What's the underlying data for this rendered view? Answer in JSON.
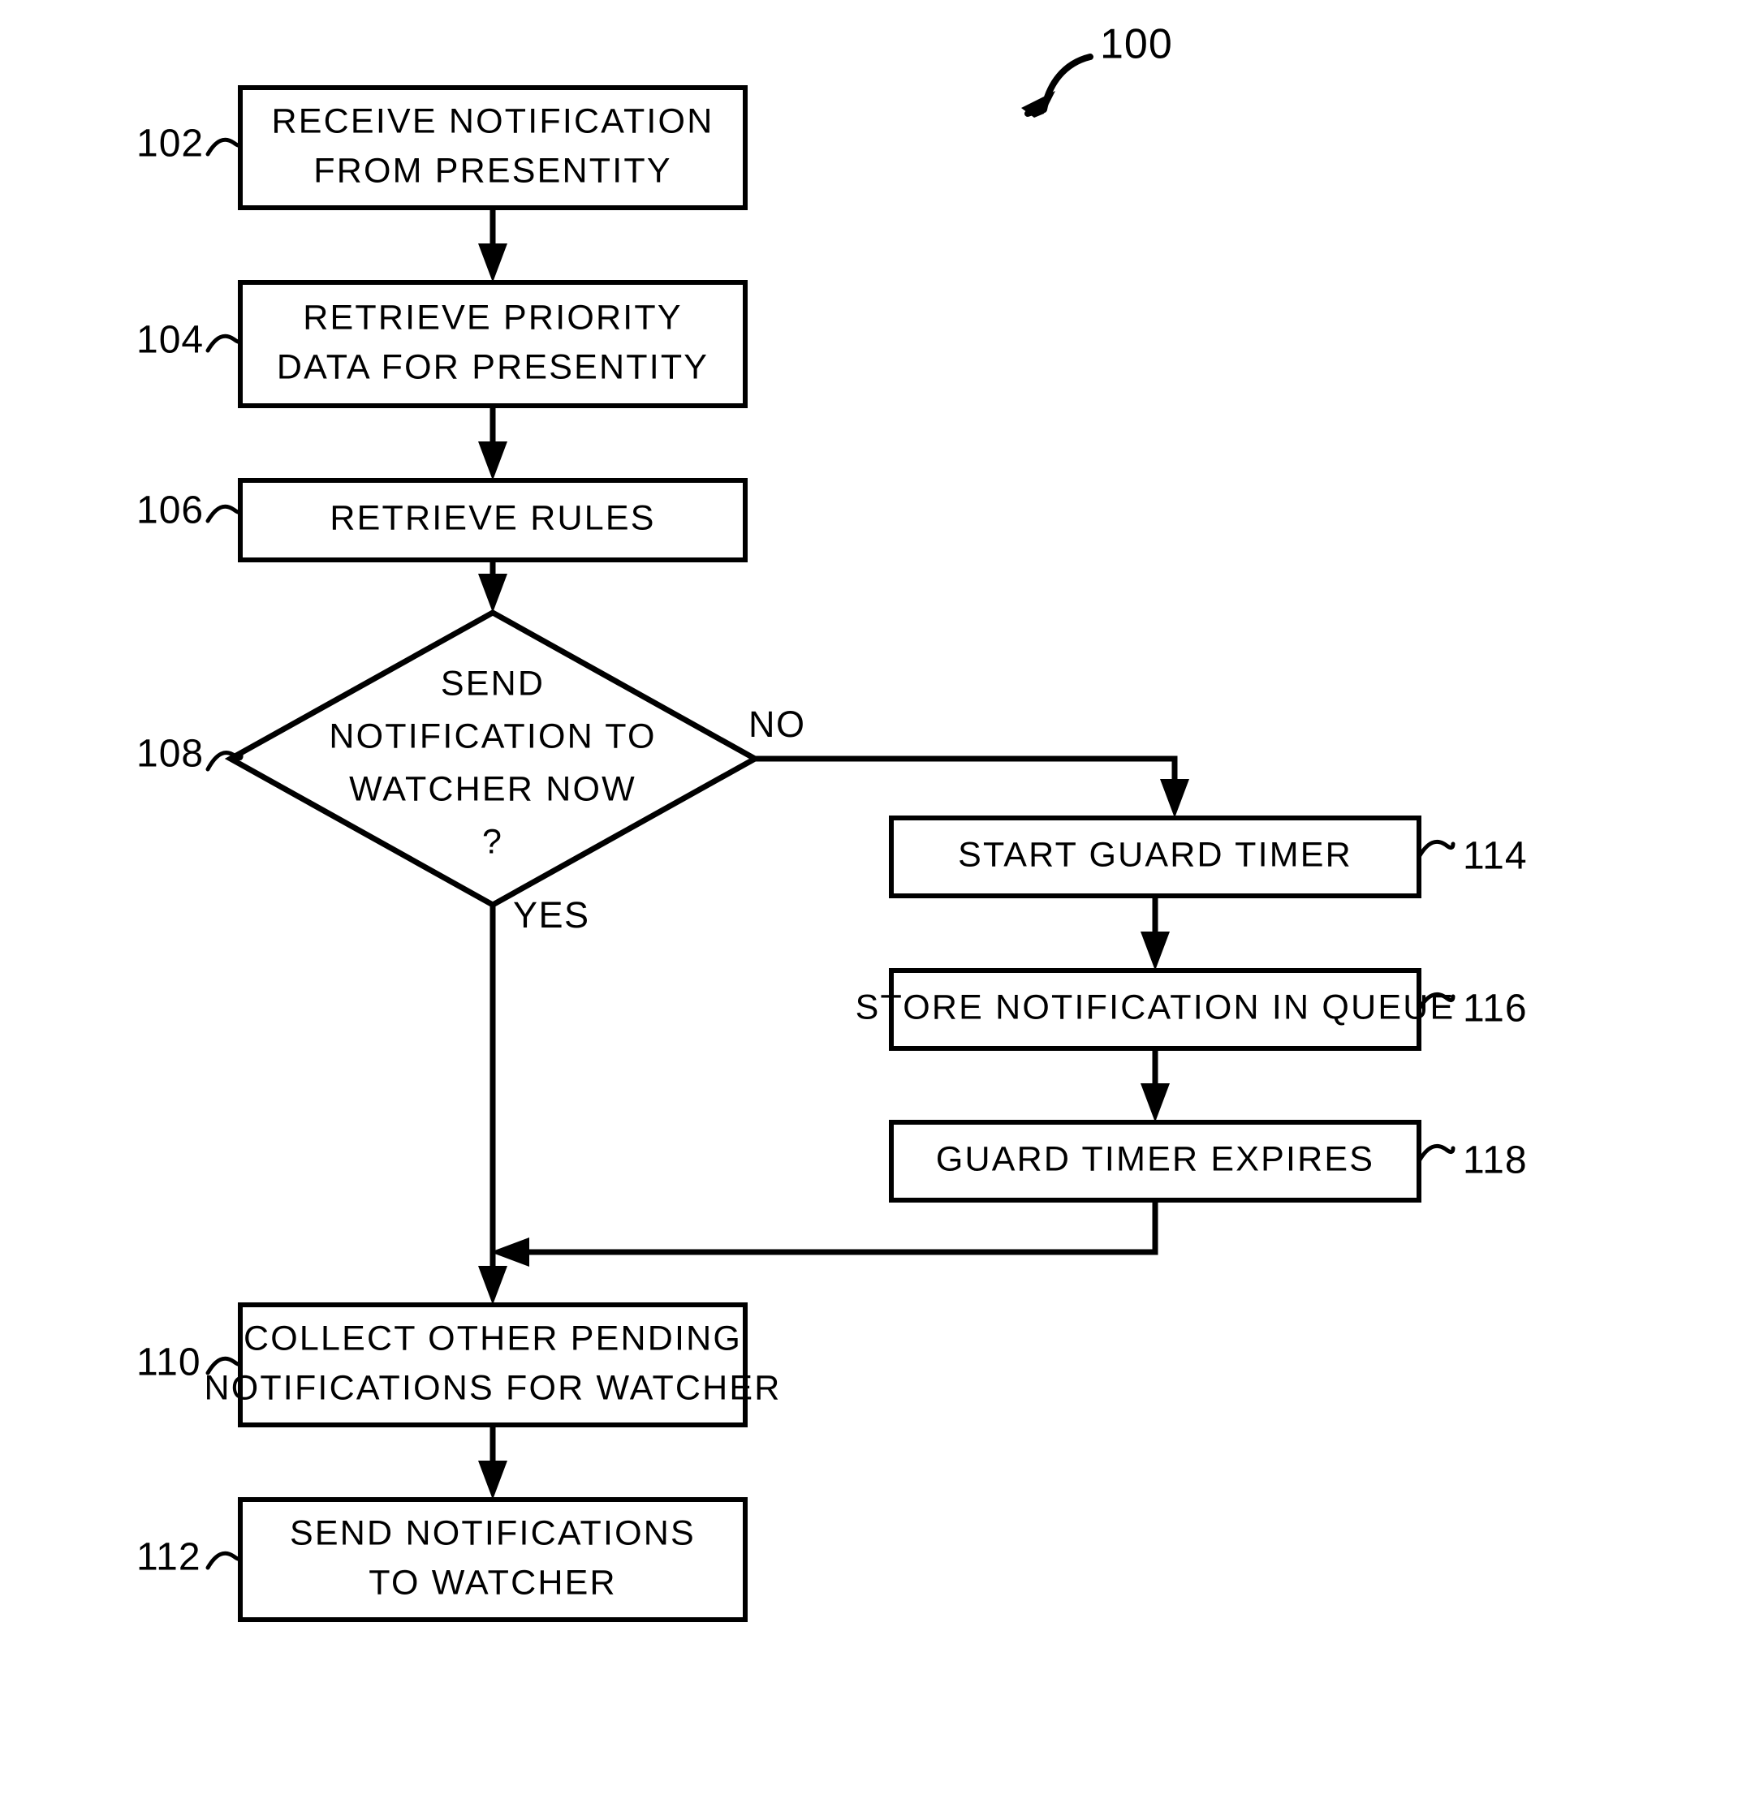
{
  "figure": {
    "number": "100",
    "type": "patent-flowchart"
  },
  "nodes": [
    {
      "id": "102",
      "ref": "102",
      "shape": "process",
      "lines": [
        "RECEIVE  NOTIFICATION",
        "FROM  PRESENTITY"
      ]
    },
    {
      "id": "104",
      "ref": "104",
      "shape": "process",
      "lines": [
        "RETRIEVE  PRIORITY",
        "DATA  FOR  PRESENTITY"
      ]
    },
    {
      "id": "106",
      "ref": "106",
      "shape": "process",
      "lines": [
        "RETRIEVE  RULES"
      ]
    },
    {
      "id": "108",
      "ref": "108",
      "shape": "decision",
      "lines": [
        "SEND",
        "NOTIFICATION TO",
        "WATCHER NOW",
        "?"
      ]
    },
    {
      "id": "114",
      "ref": "114",
      "shape": "process",
      "lines": [
        "START  GUARD  TIMER"
      ]
    },
    {
      "id": "116",
      "ref": "116",
      "shape": "process",
      "lines": [
        "STORE  NOTIFICATION  IN  QUEUE"
      ]
    },
    {
      "id": "118",
      "ref": "118",
      "shape": "process",
      "lines": [
        "GUARD  TIMER  EXPIRES"
      ]
    },
    {
      "id": "110",
      "ref": "110",
      "shape": "process",
      "lines": [
        "COLLECT  OTHER  PENDING",
        "NOTIFICATIONS  FOR  WATCHER"
      ]
    },
    {
      "id": "112",
      "ref": "112",
      "shape": "process",
      "lines": [
        "SEND  NOTIFICATIONS",
        "TO  WATCHER"
      ]
    }
  ],
  "edge_labels": {
    "no": "NO",
    "yes": "YES"
  },
  "colors": {
    "ink": "#000000",
    "paper": "#ffffff"
  }
}
